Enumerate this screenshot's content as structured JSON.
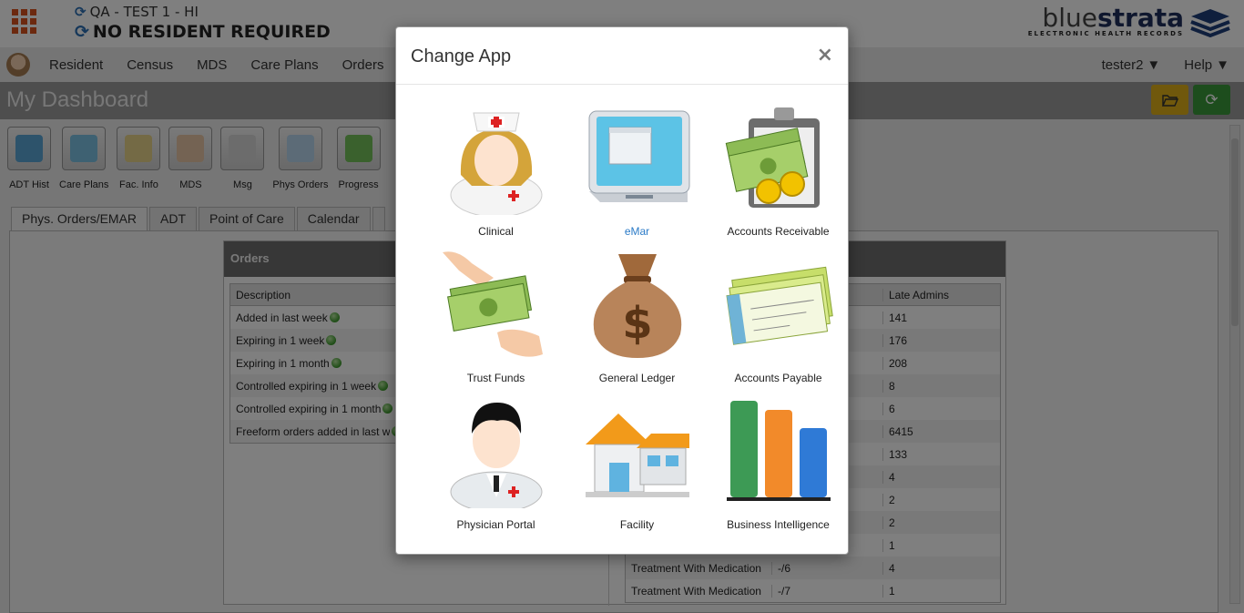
{
  "header": {
    "facility_line": "QA - TEST 1 - HI",
    "resident_line": "NO RESIDENT REQUIRED",
    "logo_light": "blue",
    "logo_bold": "strata",
    "logo_sub": "ELECTRONIC HEALTH RECORDS"
  },
  "nav": {
    "items": [
      "Resident",
      "Census",
      "MDS",
      "Care Plans",
      "Orders"
    ],
    "user": "tester2",
    "help": "Help"
  },
  "page": {
    "title": "My Dashboard"
  },
  "toolbar": [
    {
      "label": "ADT Hist",
      "icon": "adt-history-icon",
      "color": "#5aa6d6"
    },
    {
      "label": "Care Plans",
      "icon": "care-plans-icon",
      "color": "#7cc2e4"
    },
    {
      "label": "Fac. Info",
      "icon": "facility-info-icon",
      "color": "#e8d58a"
    },
    {
      "label": "MDS",
      "icon": "mds-icon",
      "color": "#e9c7a6"
    },
    {
      "label": "Msg",
      "icon": "message-icon",
      "color": "#d9d9d9"
    },
    {
      "label": "Phys Orders",
      "icon": "physician-orders-icon",
      "color": "#b9d6ef"
    },
    {
      "label": "Progress",
      "icon": "progress-icon",
      "color": "#74c35a"
    }
  ],
  "tabs": [
    "Phys. Orders/EMAR",
    "ADT",
    "Point of Care",
    "Calendar",
    ""
  ],
  "orders": {
    "title": "Orders",
    "left_header": "Description",
    "left_rows": [
      "Added in last week",
      "Expiring in 1 week",
      "Expiring in 1 month",
      "Controlled expiring in 1 week",
      "Controlled expiring in 1 month",
      "Freeform orders added in last w"
    ],
    "right_header": [
      "",
      "",
      "Late Admins"
    ],
    "right_rows": [
      [
        "",
        "",
        "141"
      ],
      [
        "",
        "",
        "176"
      ],
      [
        "",
        "",
        "208"
      ],
      [
        "",
        "",
        "8"
      ],
      [
        "",
        "",
        "6"
      ],
      [
        "",
        "",
        "6415"
      ],
      [
        "",
        "",
        "133"
      ],
      [
        "",
        "",
        "4"
      ],
      [
        "",
        "",
        "2"
      ],
      [
        "",
        "",
        "2"
      ],
      [
        "",
        "",
        "1"
      ],
      [
        "Treatment With Medication",
        "-/6",
        "4"
      ],
      [
        "Treatment With Medication",
        "-/7",
        "1"
      ]
    ]
  },
  "modal": {
    "title": "Change App",
    "close": "×",
    "apps": [
      {
        "name": "Clinical",
        "icon": "nurse-icon"
      },
      {
        "name": "eMar",
        "icon": "emar-tablet-icon"
      },
      {
        "name": "Accounts Receivable",
        "icon": "clipboard-money-icon"
      },
      {
        "name": "Trust Funds",
        "icon": "hand-money-icon"
      },
      {
        "name": "General Ledger",
        "icon": "money-bag-icon"
      },
      {
        "name": "Accounts Payable",
        "icon": "checks-icon"
      },
      {
        "name": "Physician Portal",
        "icon": "doctor-icon"
      },
      {
        "name": "Facility",
        "icon": "house-icon"
      },
      {
        "name": "Business Intelligence",
        "icon": "bar-chart-icon"
      }
    ]
  },
  "colors": {
    "accent_orange": "#d9531e",
    "link_blue": "#2a7ac7",
    "open_button": "#e0b118",
    "refresh_button": "#3a9a3a"
  }
}
